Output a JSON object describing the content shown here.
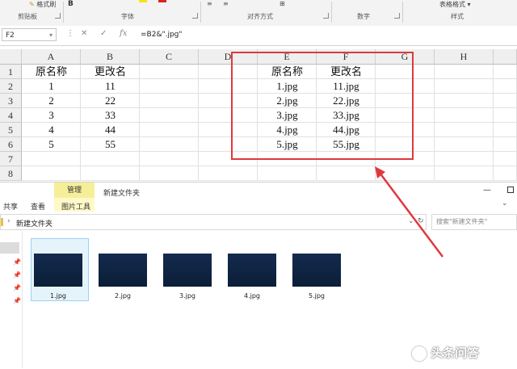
{
  "ribbon": {
    "top_labels": [
      "格式刷",
      "表格格式"
    ],
    "groups": [
      "剪贴板",
      "字体",
      "对齐方式",
      "数字",
      "样式"
    ]
  },
  "formula_bar": {
    "name_box": "F2",
    "formula": "=B2&\".jpg\""
  },
  "sheet": {
    "columns": [
      "A",
      "B",
      "C",
      "D",
      "E",
      "F",
      "G",
      "H"
    ],
    "rows": [
      "1",
      "2",
      "3",
      "4",
      "5",
      "6",
      "7",
      "8"
    ],
    "table_left": {
      "headers": [
        "原名称",
        "更改名"
      ],
      "rows": [
        [
          "1",
          "11"
        ],
        [
          "2",
          "22"
        ],
        [
          "3",
          "33"
        ],
        [
          "4",
          "44"
        ],
        [
          "5",
          "55"
        ]
      ]
    },
    "table_right": {
      "headers": [
        "原名称",
        "更改名"
      ],
      "rows": [
        [
          "1.jpg",
          "11.jpg"
        ],
        [
          "2.jpg",
          "22.jpg"
        ],
        [
          "3.jpg",
          "33.jpg"
        ],
        [
          "4.jpg",
          "44.jpg"
        ],
        [
          "5.jpg",
          "55.jpg"
        ]
      ]
    },
    "highlight_color": "#e0393d"
  },
  "explorer": {
    "tab_manage": "管理",
    "window_title": "新建文件夹",
    "tabs": [
      "共享",
      "查看",
      "图片工具"
    ],
    "address": "新建文件夹",
    "search_placeholder": "搜索\"新建文件夹\"",
    "files": [
      "1.jpg",
      "2.jpg",
      "3.jpg",
      "4.jpg",
      "5.jpg"
    ]
  },
  "watermark": "头条问答"
}
